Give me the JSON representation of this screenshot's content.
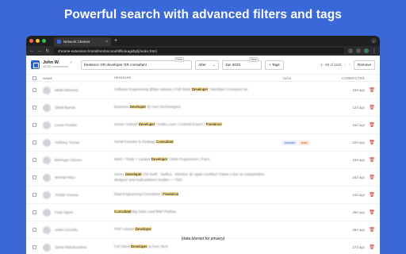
{
  "promo": {
    "headline": "Powerful search with advanced filters and tags"
  },
  "browser": {
    "tab_title": "Network Cleaner",
    "tab_close": "×",
    "new_tab": "+",
    "url": "chrome-extension://mlahfnmhmcnonfdfikokagkbpfj/index.html",
    "back": "←",
    "forward": "→",
    "reload": "↻",
    "menu": "⋮",
    "tab_menu": "⌄"
  },
  "app": {
    "user_name": "John W.",
    "twitter_glyph": "✓",
    "connections": "18782 connections",
    "search_value": "freelance OR developer OR consultant",
    "clear_label": "Clear",
    "filter_value": "After",
    "filter_chevron": "⌄",
    "date_value": "Jan 2020",
    "tags_button": "+ Tags",
    "pager_text": "1 - 50 of 1243",
    "pager_prev": "‹",
    "pager_next": "›",
    "remove_button": "Remove"
  },
  "columns": {
    "name": "Name",
    "headline": "Headline",
    "tags": "Tags",
    "connected": "Connected"
  },
  "rows": [
    {
      "name": "Mitali Mahmed",
      "pre": "Software Engineering @Bar Industry | Full Stack ",
      "hl": "Developer",
      "post": " | Meridian | Liverpool UK",
      "tags": [],
      "connected": "23d ago"
    },
    {
      "name": "Sibell Barrett",
      "pre": "Business ",
      "hl": "Developer",
      "post": " @ Fern Technologies",
      "tags": [],
      "connected": "12d ago"
    },
    {
      "name": "Lucas Rossler",
      "pre": "Senior Android ",
      "hl": "Developer",
      "post": " | Kotlin Lover | Android Expert | ",
      "hl2": "Freelance",
      "tags": [],
      "connected": "15d ago"
    },
    {
      "name": "Anthony Touras",
      "pre": "Serial Founder & Strategy ",
      "hl": "Consultant",
      "post": "",
      "tags": [
        {
          "label": "founder",
          "color": "blue"
        },
        {
          "label": "lead",
          "color": "orange"
        }
      ],
      "connected": "22d ago"
    },
    {
      "name": "Bérenger Gleano",
      "pre": "Mind + Node + Laravel ",
      "hl": "Developer",
      "post": " | Web Programmer | Paris",
      "tags": [],
      "connected": "23d ago"
    },
    {
      "name": "Michael Meu",
      "pre": "Senior ",
      "hl": "Developer",
      "post": " iOS Swift · SwiftUI · Member @ Apple Certified Trainer | Also an independent designer and multi-platform builder — TDD",
      "tags": [],
      "connected": "24d ago"
    },
    {
      "name": "Jordan Gouras",
      "pre": "Data Engineering Consultant | ",
      "hl": "Freelance",
      "post": "",
      "tags": [],
      "connected": "24d ago"
    },
    {
      "name": "Firas Sgant",
      "pre": "",
      "hl": "Consultant",
      "post": " Big Data Lead BNP Paribas",
      "tags": [],
      "connected": "25d ago"
    },
    {
      "name": "Julien Gourdin",
      "pre": "PHP Laravel ",
      "hl": "Developer",
      "post": "",
      "tags": [],
      "connected": "26d ago"
    },
    {
      "name": "Sylvie Rakotorahina",
      "pre": "Full Stack ",
      "hl": "Developer",
      "post": " at Fern Tech",
      "tags": [],
      "connected": "27d ago"
    }
  ],
  "footnote": "(data blurred for privacy)",
  "colors": {
    "background": "#3a68d8",
    "accent": "#2f5fd0",
    "highlight": "#fbe3a0",
    "danger": "#cc3333"
  }
}
